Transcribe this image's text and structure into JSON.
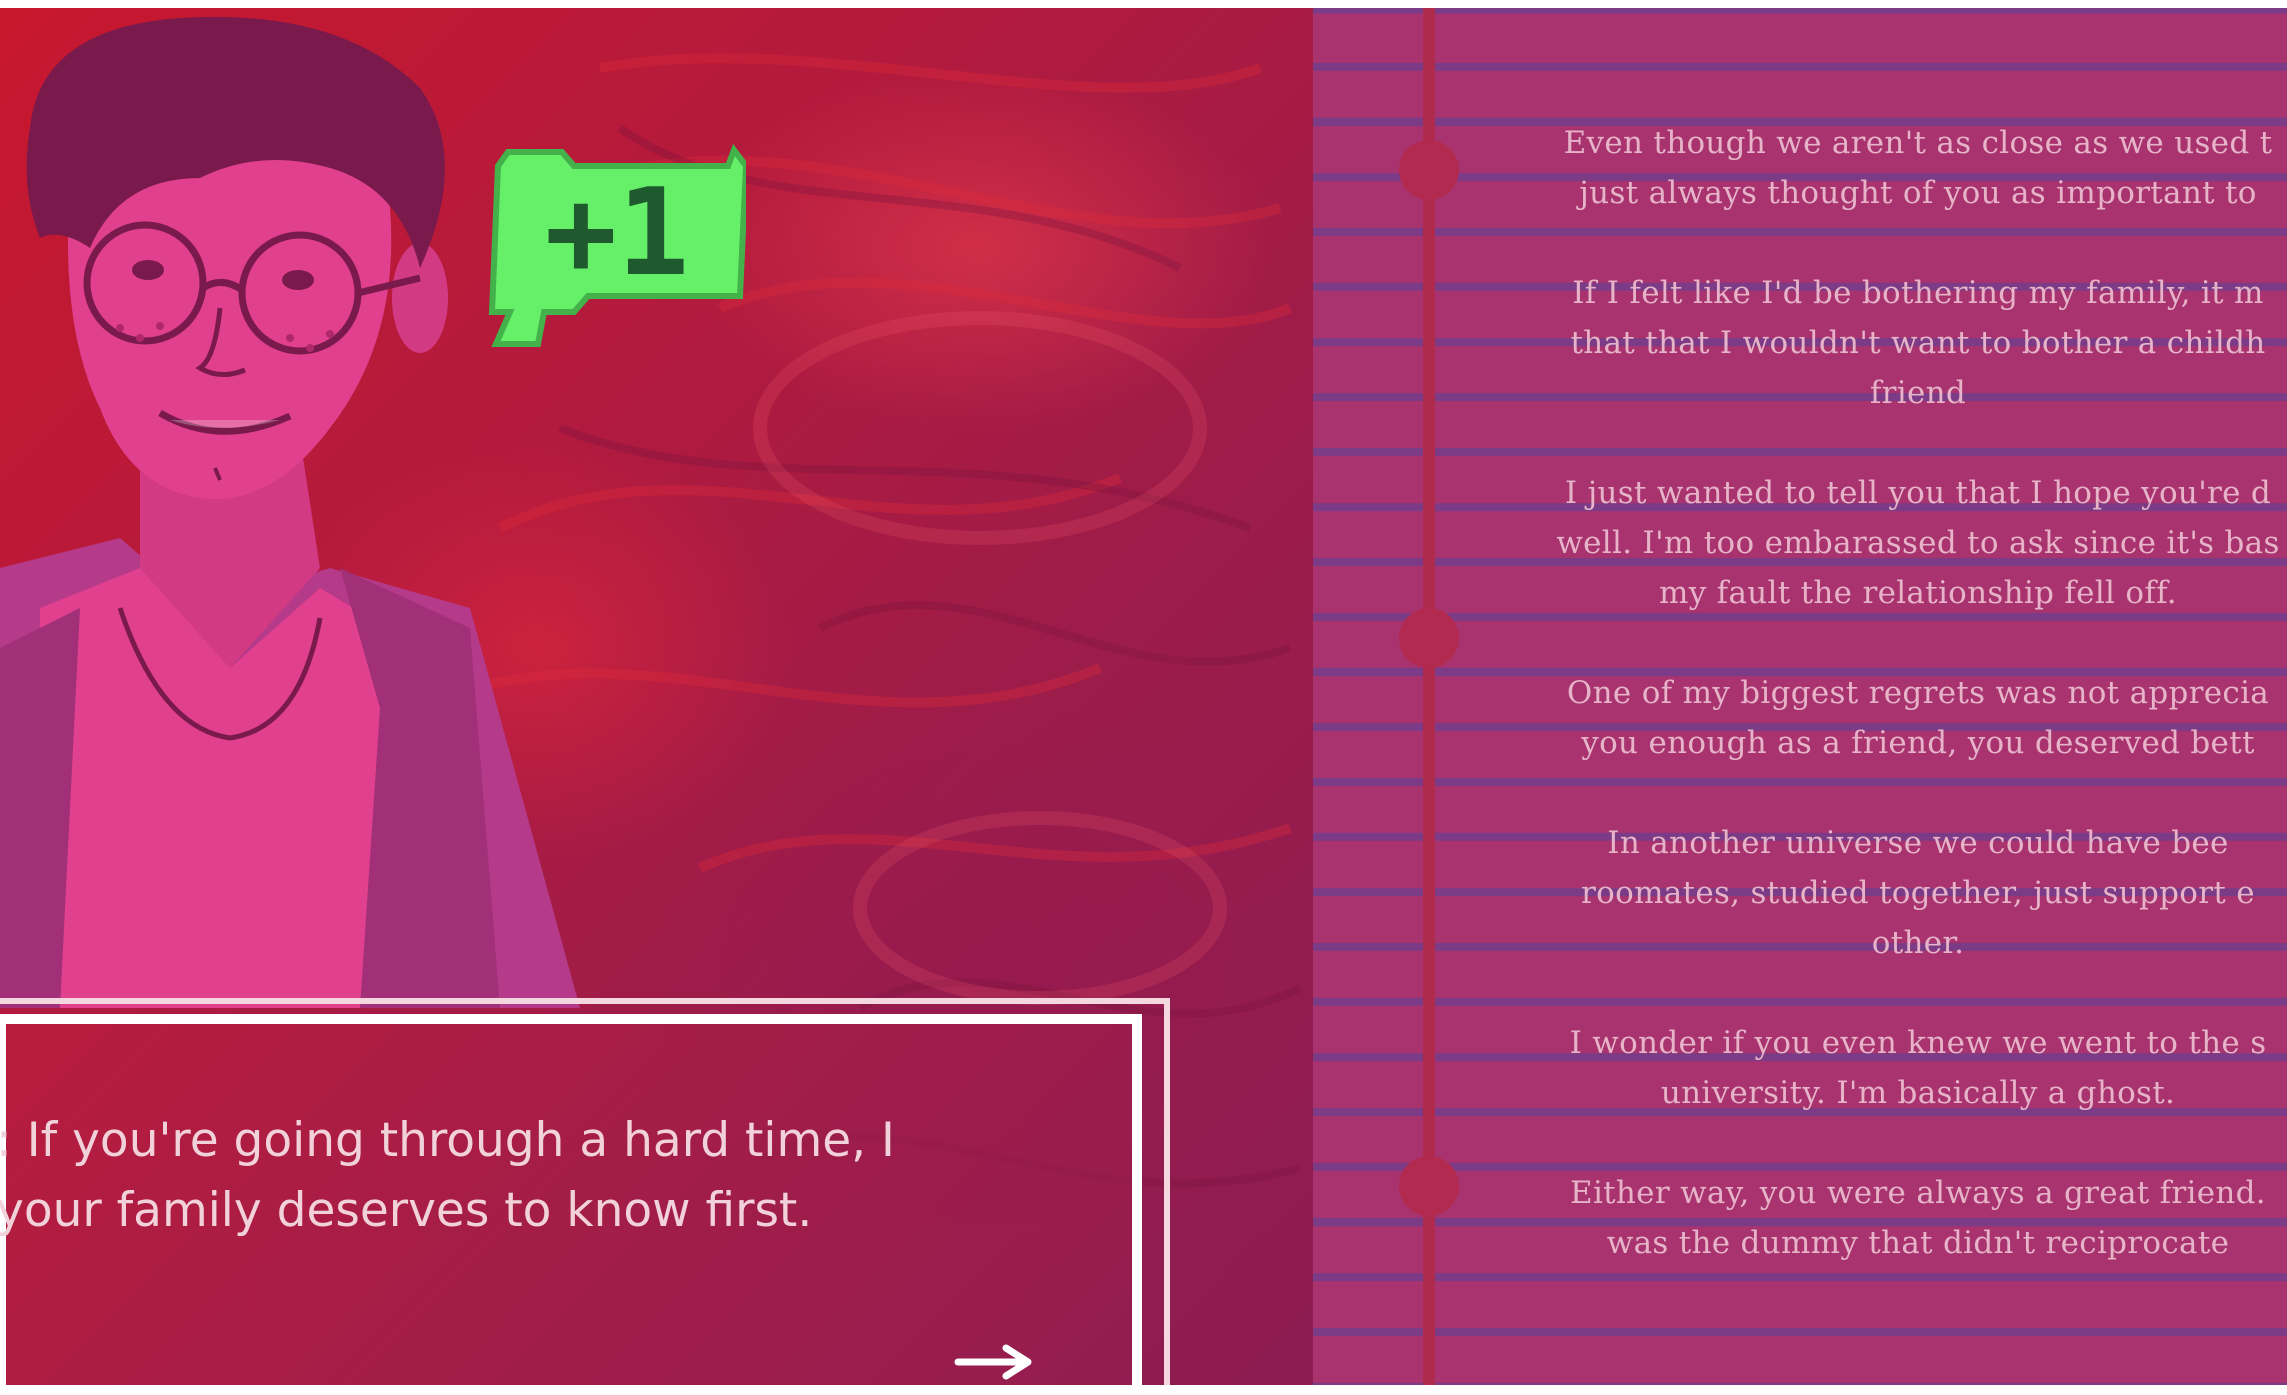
{
  "points_badge": {
    "label": "+1",
    "color": "#66f06a"
  },
  "dialogue": {
    "text": ": If you're going through a hard time, I\n your family deserves to know first."
  },
  "next_arrow": {
    "icon": "arrow-right-icon",
    "glyph": "⟶"
  },
  "notebook": {
    "entries": [
      "Even though we aren't as close as we used t\njust always thought of you as important to",
      "If I felt like I'd be bothering my family, it m\nthat that I wouldn't want to bother a childh\nfriend",
      "I just wanted to tell you that I hope you're d\nwell. I'm too embarassed to ask since it's bas\nmy fault the relationship fell off.",
      "One of my biggest regrets was not apprecia\nyou enough as a friend, you deserved bett",
      "In another universe we could have bee\nroomates, studied together, just support e\nother.",
      "I wonder if you even knew we went to the s\nuniversity. I'm basically a ghost.",
      "Either way, you were always a great friend.\nwas the dummy that didn't reciprocate"
    ]
  },
  "colors": {
    "scene_red": "#c8182e",
    "notebook_bg": "#a8336f",
    "notebook_rule": "#7b3b86",
    "margin_line": "#b02a4e",
    "character_skin": "#e0408e",
    "character_hair": "#7a1a4c"
  }
}
